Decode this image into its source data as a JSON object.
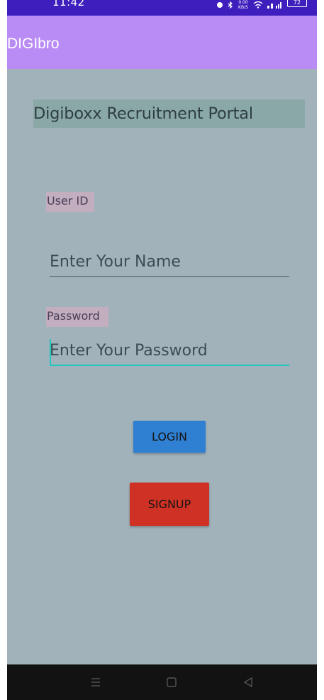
{
  "status_bar": {
    "time": "11:42",
    "network_speed": "0.00 KB/S",
    "battery": "72",
    "background": "#3e1fbd"
  },
  "app_bar": {
    "title": "DIGIbro",
    "background": "#b98bf5"
  },
  "main": {
    "title": "Digiboxx Recruitment Portal",
    "user_id_label": "User ID",
    "name_placeholder": "Enter Your Name",
    "password_label": "Password",
    "password_placeholder": "Enter Your Password",
    "login_label": "LOGIN",
    "signup_label": "SIGNUP",
    "colors": {
      "background": "#a1b2ba",
      "login": "#2f7fd3",
      "signup": "#cf3224",
      "focus_line": "#22c8c0"
    }
  },
  "nav_bar": {
    "icons": [
      "menu-icon",
      "home-icon",
      "back-icon"
    ]
  }
}
